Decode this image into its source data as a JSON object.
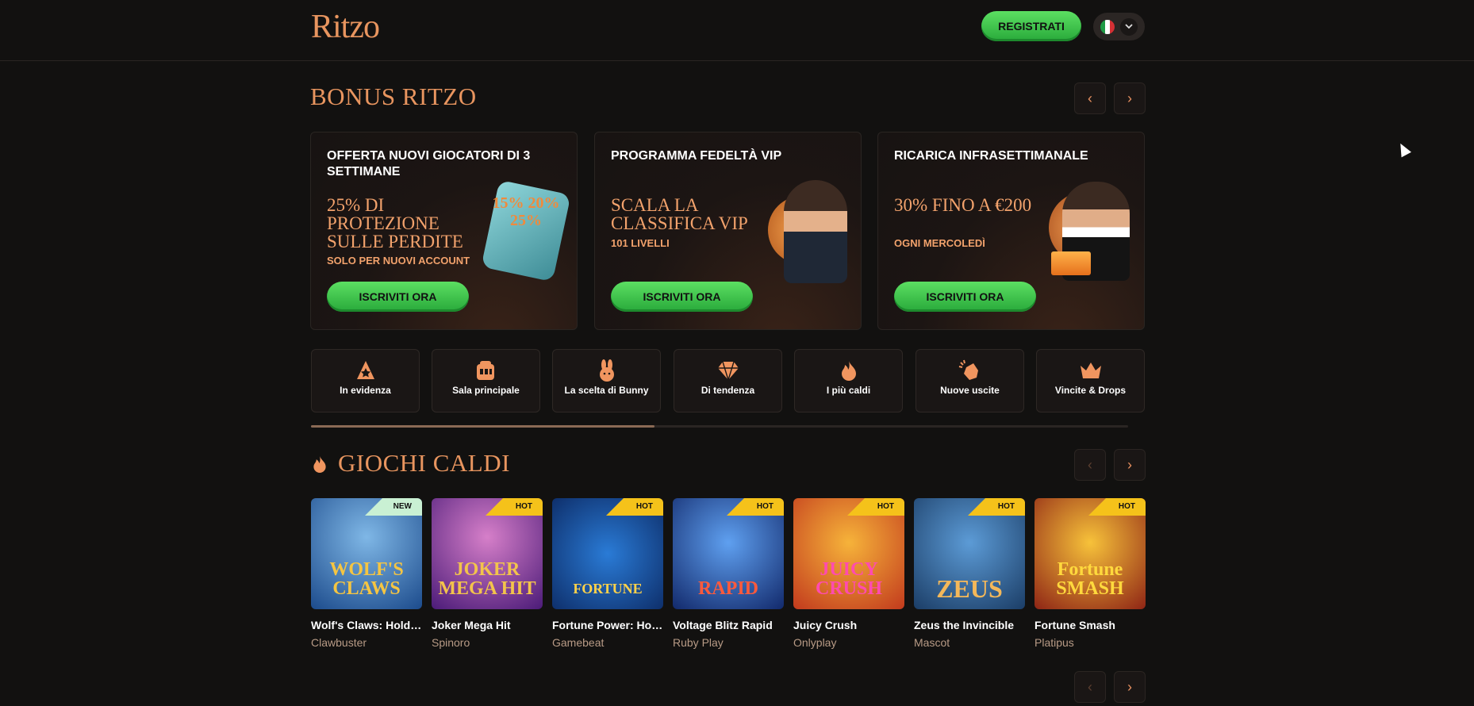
{
  "header": {
    "logo": "Ritzo",
    "register_label": "REGISTRATI",
    "language_flag": "it-flag",
    "language_chevron": "⌄"
  },
  "bonus": {
    "title": "BONUS RITZO",
    "prev": "‹",
    "next": "›",
    "cards": [
      {
        "title": "OFFERTA NUOVI GIOCATORI DI 3 SETTIMANE",
        "headline": "25% DI PROTEZIONE SULLE PERDITE",
        "sub": "SOLO PER NUOVI ACCOUNT",
        "cta": "ISCRIVITI ORA",
        "art_text": "15% 20% 25%"
      },
      {
        "title": "PROGRAMMA FEDELTÀ VIP",
        "headline": "SCALA LA CLASSIFICA VIP",
        "sub": "101 LIVELLI",
        "cta": "ISCRIVITI ORA",
        "art_text": ""
      },
      {
        "title": "RICARICA INFRASETTIMANALE",
        "headline": "30% FINO A €200",
        "sub": "OGNI MERCOLEDÌ",
        "cta": "ISCRIVITI ORA",
        "art_text": ""
      }
    ]
  },
  "categories": [
    {
      "label": "In evidenza",
      "icon": "⚠"
    },
    {
      "label": "Sala principale",
      "icon": "🎰"
    },
    {
      "label": "La scelta di Bunny",
      "icon": "🐰"
    },
    {
      "label": "Di tendenza",
      "icon": "♦"
    },
    {
      "label": "I più caldi",
      "icon": "🔥"
    },
    {
      "label": "Nuove uscite",
      "icon": "👏"
    },
    {
      "label": "Vincite & Drops",
      "icon": "♛"
    }
  ],
  "category_scroll_progress": 0.42,
  "hot_games": {
    "title": "GIOCHI CALDI",
    "prev": "‹",
    "next": "›",
    "games": [
      {
        "name": "Wolf's Claws: Hold ...",
        "provider": "Clawbuster",
        "badge": "NEW",
        "art": "WOLF'S CLAWS"
      },
      {
        "name": "Joker Mega Hit",
        "provider": "Spinoro",
        "badge": "HOT",
        "art": "JOKER MEGA HIT"
      },
      {
        "name": "Fortune Power: Hol...",
        "provider": "Gamebeat",
        "badge": "HOT",
        "art": "FORTUNE"
      },
      {
        "name": "Voltage Blitz Rapid",
        "provider": "Ruby Play",
        "badge": "HOT",
        "art": "RAPID"
      },
      {
        "name": "Juicy Crush",
        "provider": "Onlyplay",
        "badge": "HOT",
        "art": "JUICY CRUSH"
      },
      {
        "name": "Zeus the Invincible",
        "provider": "Mascot",
        "badge": "HOT",
        "art": "ZEUS"
      },
      {
        "name": "Fortune Smash",
        "provider": "Platipus",
        "badge": "HOT",
        "art": "Fortune SMASH"
      }
    ]
  },
  "bottom_nav": {
    "prev": "‹",
    "next": "›"
  },
  "colors": {
    "accent": "#e8955f",
    "cta_green": "#3cc64a",
    "hot_badge": "#f5c21a",
    "new_badge": "#c9f0d3"
  }
}
